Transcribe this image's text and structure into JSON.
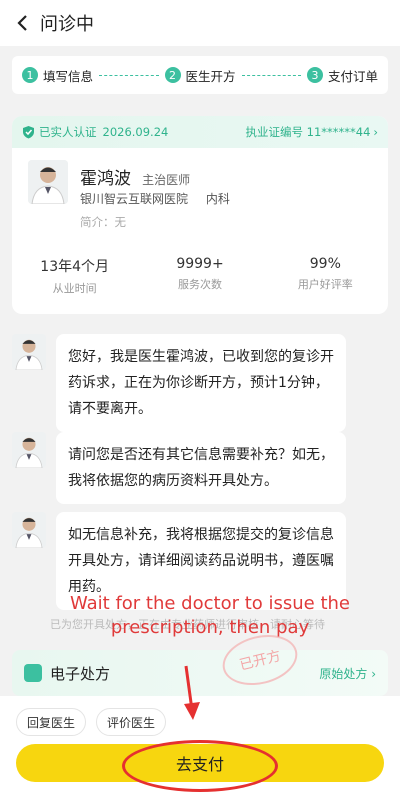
{
  "header": {
    "title": "问诊中"
  },
  "steps": [
    {
      "num": "1",
      "label": "填写信息"
    },
    {
      "num": "2",
      "label": "医生开方"
    },
    {
      "num": "3",
      "label": "支付订单"
    }
  ],
  "doctor": {
    "verified_label": "已实人认证",
    "verified_date": "2026.09.24",
    "license": "执业证编号 11******44",
    "name": "霍鸿波",
    "title": "主治医师",
    "hospital": "银川智云互联网医院",
    "department": "内科",
    "intro": "简介：无",
    "stats": [
      {
        "value": "13年4个月",
        "label": "从业时间"
      },
      {
        "value": "9999+",
        "label": "服务次数"
      },
      {
        "value": "99%",
        "label": "用户好评率"
      }
    ]
  },
  "messages": [
    {
      "text": "您好，我是医生霍鸿波，已收到您的复诊开药诉求，正在为你诊断开方，预计1分钟，请不要离开。"
    },
    {
      "text": "请问您是否还有其它信息需要补充？如无，我将依据您的病历资料开具处方。"
    },
    {
      "text": "如无信息补充，我将根据您提交的复诊信息开具处方，请详细阅读药品说明书，遵医嘱用药。"
    }
  ],
  "annotation": "Wait for the doctor to issue the prescription, then pay",
  "note": "已为您开具处方，正在由专业药师进行审核，请耐心等待",
  "prescription": {
    "title": "电子处方",
    "link": "原始处方",
    "stamp": "已开方"
  },
  "actions": {
    "reply": "回复医生",
    "rate": "评价医生",
    "pay": "去支付"
  },
  "colors": {
    "accent": "#3cc0a0",
    "pay_button": "#f7d60f",
    "annotation": "#e03a3a"
  }
}
